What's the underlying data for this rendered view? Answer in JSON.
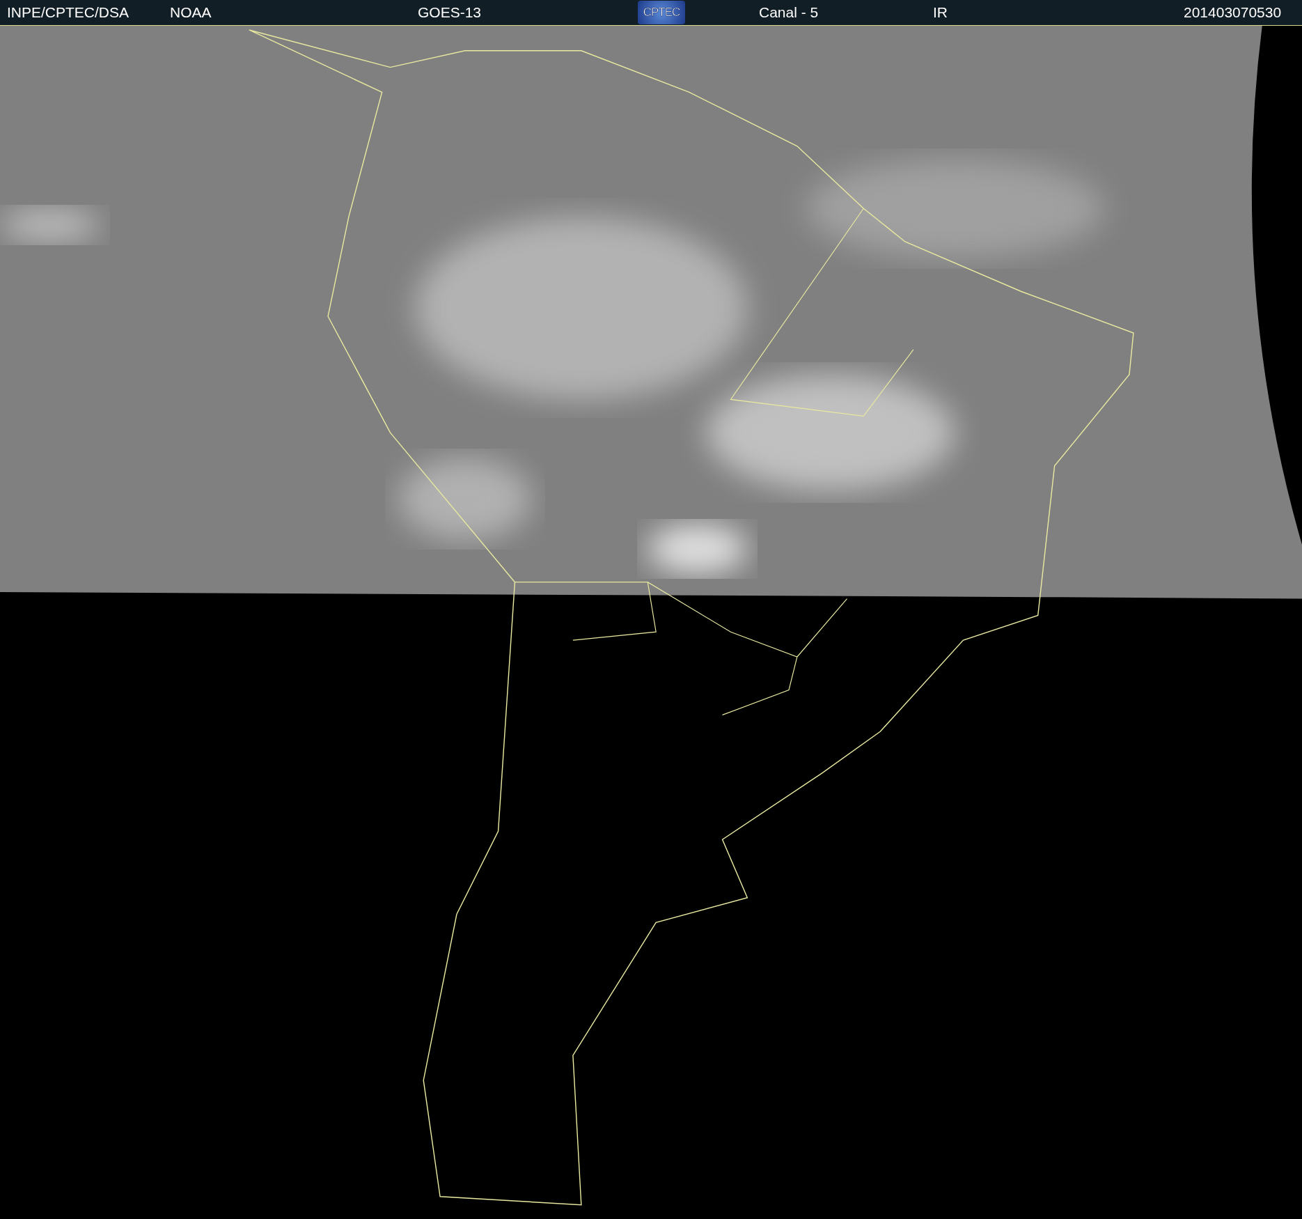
{
  "header": {
    "items": [
      {
        "kind": "text",
        "text": "INPE/CPTEC/DSA"
      },
      {
        "kind": "text",
        "text": "NOAA"
      },
      {
        "kind": "text",
        "text": "GOES-13"
      },
      {
        "kind": "logo",
        "text": "CPTEC"
      },
      {
        "kind": "text",
        "text": "Canal - 5"
      },
      {
        "kind": "text",
        "text": "IR"
      },
      {
        "kind": "text",
        "text": "201403070530"
      }
    ]
  }
}
